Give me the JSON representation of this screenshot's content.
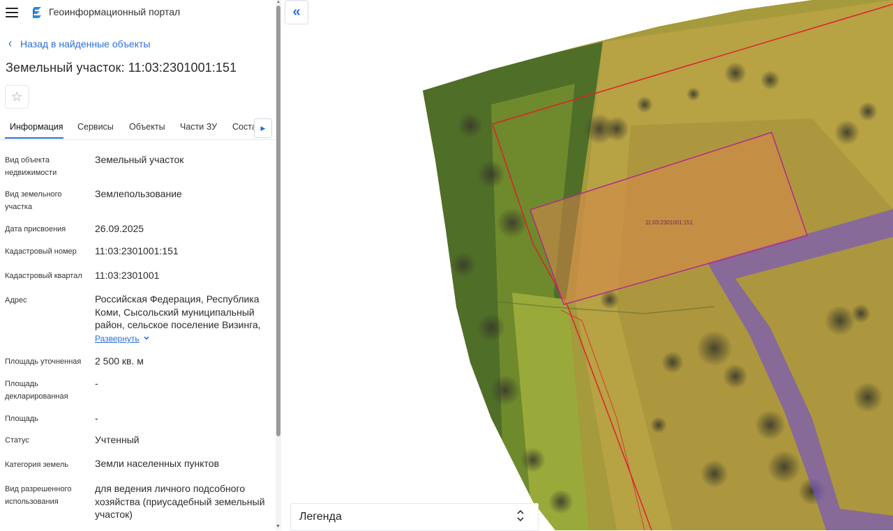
{
  "header": {
    "app_title": "Геоинформационный портал",
    "menu_icon": "hamburger-menu-icon",
    "logo_icon": "portal-logo-icon"
  },
  "back_link": {
    "label": "Назад в найденные объекты",
    "icon": "chevron-left-icon"
  },
  "page_title": "Земельный участок: 11:03:2301001:151",
  "favorite_icon": "star-outline-icon",
  "tabs": [
    {
      "label": "Информация",
      "active": true
    },
    {
      "label": "Сервисы"
    },
    {
      "label": "Объекты"
    },
    {
      "label": "Части ЗУ"
    },
    {
      "label": "Соста"
    }
  ],
  "details": [
    {
      "label": "Вид объекта недвижимости",
      "value": "Земельный участок"
    },
    {
      "label": "Вид земельного участка",
      "value": "Землепользование"
    },
    {
      "label": "Дата присвоения",
      "value": "26.09.2025"
    },
    {
      "label": "Кадастровый номер",
      "value": "11:03:2301001:151"
    },
    {
      "label": "Кадастровый квартал",
      "value": "11:03:2301001"
    },
    {
      "label": "Адрес",
      "value": "Российская Федерация, Республика Коми, Сысольский муниципальный район, сельское поселение Визинга,"
    },
    {
      "label": "Площадь уточненная",
      "value": "2 500 кв. м"
    },
    {
      "label": "Площадь декларированная",
      "value": "-"
    },
    {
      "label": "Площадь",
      "value": "-"
    },
    {
      "label": "Статус",
      "value": "Учтенный"
    },
    {
      "label": "Категория земель",
      "value": "Земли населенных пунктов"
    },
    {
      "label": "Вид разрешенного использования",
      "value": "для ведения личного подсобного хозяйства (приусадебный земельный участок)"
    }
  ],
  "expand_link": "Развернуть",
  "map": {
    "parcel_label": "11:03:2301001:151",
    "colors": {
      "boundary_red": "#e0202e",
      "parcel_outline": "#b02a8a",
      "parcel_fill": "#d8874a",
      "road_band": "#6f4fd0",
      "vegetation": "#6f8a2a",
      "accent": "#2a6fd6"
    }
  },
  "collapse_icon": "double-chevron-left-icon",
  "legend": {
    "label": "Легенда",
    "toggle_icon": "expand-collapse-icon"
  }
}
